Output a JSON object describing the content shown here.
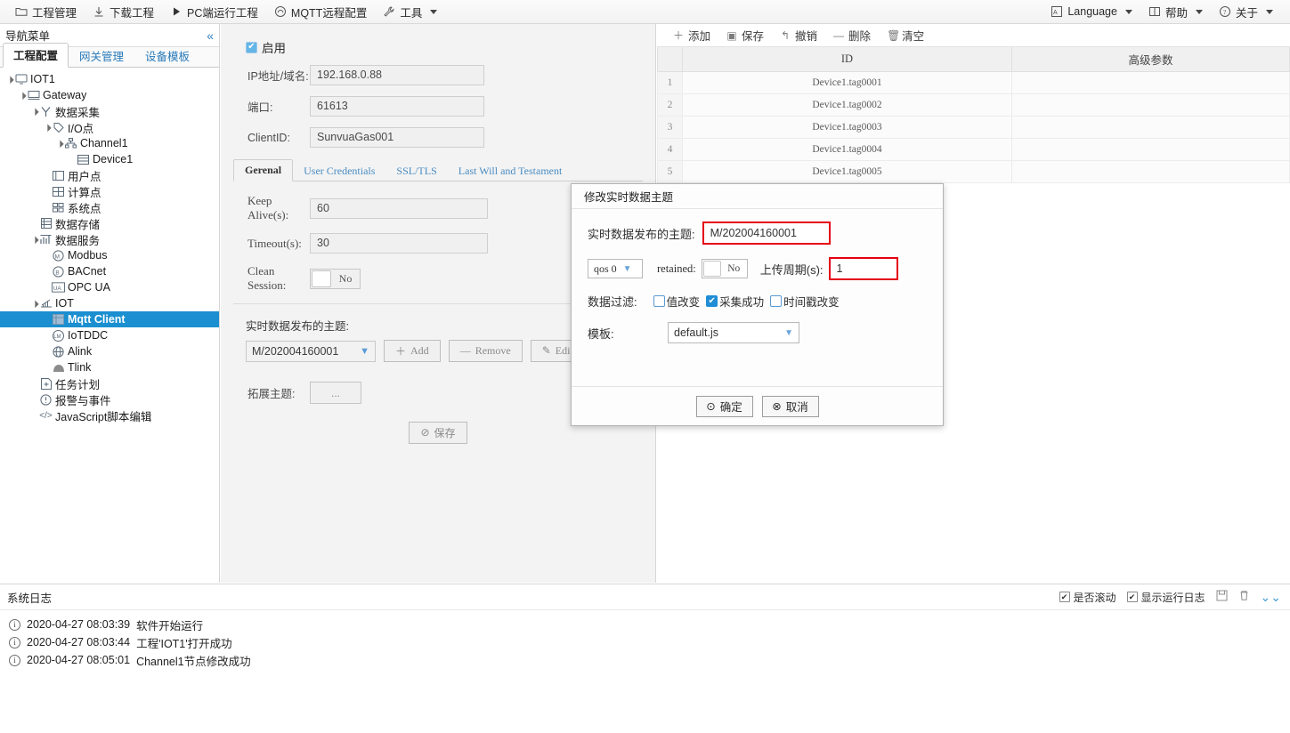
{
  "menubar": {
    "left_items": [
      {
        "label": "工程管理",
        "icon": "folder-icon"
      },
      {
        "label": "下载工程",
        "icon": "download-icon"
      },
      {
        "label": "PC端运行工程",
        "icon": "play-icon"
      },
      {
        "label": "MQTT远程配置",
        "icon": "cloud-icon"
      },
      {
        "label": "工具",
        "icon": "wrench-icon",
        "caret": true
      }
    ],
    "right_items": [
      {
        "label": "Language",
        "icon": "language-icon",
        "caret": true
      },
      {
        "label": "帮助",
        "icon": "book-icon",
        "caret": true
      },
      {
        "label": "关于",
        "icon": "question-circle-icon",
        "caret": true
      }
    ]
  },
  "nav": {
    "header_title": "导航菜单",
    "collapse_icon": "«",
    "tabs": [
      {
        "label": "工程配置",
        "active": true
      },
      {
        "label": "网关管理",
        "active": false
      },
      {
        "label": "设备模板",
        "active": false
      }
    ],
    "tree": [
      {
        "label": "IOT1",
        "indent": 0,
        "twisty": "▲",
        "icon": "monitor-icon",
        "selected": false
      },
      {
        "label": "Gateway",
        "indent": 1,
        "twisty": "▲",
        "icon": "gateway-icon",
        "selected": false
      },
      {
        "label": "数据采集",
        "indent": 2,
        "twisty": "▲",
        "icon": "collect-icon",
        "selected": false
      },
      {
        "label": "I/O点",
        "indent": 3,
        "twisty": "▲",
        "icon": "tag-icon",
        "selected": false
      },
      {
        "label": "Channel1",
        "indent": 4,
        "twisty": "▲",
        "icon": "channel-icon",
        "selected": false
      },
      {
        "label": "Device1",
        "indent": 5,
        "twisty": "",
        "icon": "device-icon",
        "selected": false
      },
      {
        "label": "用户点",
        "indent": 3,
        "twisty": "",
        "icon": "userpoint-icon",
        "selected": false
      },
      {
        "label": "计算点",
        "indent": 3,
        "twisty": "",
        "icon": "calcpoint-icon",
        "selected": false
      },
      {
        "label": "系统点",
        "indent": 3,
        "twisty": "",
        "icon": "syspoint-icon",
        "selected": false
      },
      {
        "label": "数据存储",
        "indent": 2,
        "twisty": "",
        "icon": "storage-icon",
        "selected": false
      },
      {
        "label": "数据服务",
        "indent": 2,
        "twisty": "▲",
        "icon": "service-icon",
        "selected": false
      },
      {
        "label": "Modbus",
        "indent": 3,
        "twisty": "",
        "icon": "modbus-icon",
        "selected": false
      },
      {
        "label": "BACnet",
        "indent": 3,
        "twisty": "",
        "icon": "bacnet-icon",
        "selected": false
      },
      {
        "label": "OPC UA",
        "indent": 3,
        "twisty": "",
        "icon": "opcua-icon",
        "selected": false
      },
      {
        "label": "IOT",
        "indent": 2,
        "twisty": "▲",
        "icon": "iot-icon",
        "selected": false
      },
      {
        "label": "Mqtt Client",
        "indent": 3,
        "twisty": "",
        "icon": "mqtt-icon",
        "selected": true
      },
      {
        "label": "IoTDDC",
        "indent": 3,
        "twisty": "",
        "icon": "iotddc-icon",
        "selected": false
      },
      {
        "label": "Alink",
        "indent": 3,
        "twisty": "",
        "icon": "alink-icon",
        "selected": false
      },
      {
        "label": "Tlink",
        "indent": 3,
        "twisty": "",
        "icon": "tlink-icon",
        "selected": false
      },
      {
        "label": "任务计划",
        "indent": 2,
        "twisty": "",
        "icon": "schedule-icon",
        "selected": false
      },
      {
        "label": "报警与事件",
        "indent": 2,
        "twisty": "",
        "icon": "alarm-icon",
        "selected": false
      },
      {
        "label": "JavaScript脚本编辑",
        "indent": 2,
        "twisty": "",
        "icon": "script-icon",
        "selected": false
      }
    ]
  },
  "form": {
    "enable_label": "启用",
    "enable_checked": true,
    "fields": [
      {
        "label": "IP地址/域名:",
        "value": "192.168.0.88"
      },
      {
        "label": "端口:",
        "value": "61613"
      },
      {
        "label": "ClientID:",
        "value": "SunvuaGas001"
      }
    ],
    "tabs": [
      {
        "label": "Gerenal",
        "active": true
      },
      {
        "label": "User Credentials",
        "active": false
      },
      {
        "label": "SSL/TLS",
        "active": false
      },
      {
        "label": "Last Will and Testament",
        "active": false
      }
    ],
    "keep_alive_label": "Keep Alive(s):",
    "keep_alive_value": "60",
    "timeout_label": "Timeout(s):",
    "timeout_value": "30",
    "clean_session_label": "Clean Session:",
    "clean_session_value": "No",
    "topic_section_title": "实时数据发布的主题:",
    "topic_selected": "M/202004160001",
    "add_label": "Add",
    "remove_label": "Remove",
    "edit_label": "Edit",
    "extend_topic_label": "拓展主题:",
    "extend_topic_value": "...",
    "save_label": "保存"
  },
  "table": {
    "toolbar": [
      {
        "label": "添加",
        "icon": "plus-icon"
      },
      {
        "label": "保存",
        "icon": "save-icon"
      },
      {
        "label": "撤销",
        "icon": "undo-icon"
      },
      {
        "label": "删除",
        "icon": "minus-icon"
      },
      {
        "label": "清空",
        "icon": "trash-icon"
      }
    ],
    "columns": [
      "",
      "ID",
      "高级参数"
    ],
    "rows": [
      {
        "index": "1",
        "id": "Device1.tag0001",
        "param": ""
      },
      {
        "index": "2",
        "id": "Device1.tag0002",
        "param": ""
      },
      {
        "index": "3",
        "id": "Device1.tag0003",
        "param": ""
      },
      {
        "index": "4",
        "id": "Device1.tag0004",
        "param": ""
      },
      {
        "index": "5",
        "id": "Device1.tag0005",
        "param": ""
      }
    ]
  },
  "modal": {
    "title": "修改实时数据主题",
    "topic_label": "实时数据发布的主题:",
    "topic_value": "M/202004160001",
    "qos_value": "qos 0",
    "retained_label": "retained:",
    "retained_value": "No",
    "period_label": "上传周期(s):",
    "period_value": "1",
    "filter_label": "数据过滤:",
    "filters": [
      {
        "label": "值改变",
        "checked": false
      },
      {
        "label": "采集成功",
        "checked": true
      },
      {
        "label": "时间戳改变",
        "checked": false
      }
    ],
    "template_label": "模板:",
    "template_value": "default.js",
    "ok_label": "确定",
    "cancel_label": "取消",
    "highlight_color": "#e60012"
  },
  "log": {
    "title": "系统日志",
    "auto_scroll_label": "是否滚动",
    "auto_scroll_checked": true,
    "show_runlog_label": "显示运行日志",
    "show_runlog_checked": true,
    "icons": [
      "save-icon",
      "trash-icon",
      "collapse-down-icon"
    ],
    "entries": [
      {
        "time": "2020-04-27 08:03:39",
        "text": "软件开始运行"
      },
      {
        "time": "2020-04-27 08:03:44",
        "text": "工程'IOT1'打开成功"
      },
      {
        "time": "2020-04-27 08:05:01",
        "text": "Channel1节点修改成功"
      }
    ]
  },
  "theme": {
    "accent": "#1b8fd0",
    "link": "#2a7bb9",
    "panel_bg": "#f3f3f3",
    "alert": "#e60012"
  }
}
